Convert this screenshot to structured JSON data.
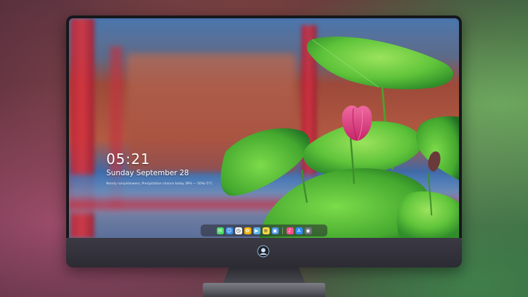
{
  "lockscreen": {
    "time": "05:21",
    "date": "Sunday September  28",
    "status": "Nearly rainy/showers, Precipitation chance today 39% — 50%/-5°C"
  },
  "dock": {
    "icons": [
      {
        "name": "messages-icon",
        "glyph": "✉",
        "color": "#4cd964"
      },
      {
        "name": "finder-icon",
        "glyph": "☺",
        "color": "#3a8ee6"
      },
      {
        "name": "clock-icon",
        "glyph": "◷",
        "color": "#f2f2f2"
      },
      {
        "name": "photos-icon",
        "glyph": "✿",
        "color": "#f5b400"
      },
      {
        "name": "claquette-icon",
        "glyph": "▶",
        "color": "#5ab4e8"
      },
      {
        "name": "notes-icon",
        "glyph": "≡",
        "color": "#ffd84a"
      },
      {
        "name": "gallery-icon",
        "glyph": "▣",
        "color": "#4a90e2"
      },
      {
        "name": "music-icon",
        "glyph": "♪",
        "color": "#ff4f8b"
      },
      {
        "name": "app-store-icon",
        "glyph": "A",
        "color": "#2f8cff"
      },
      {
        "name": "camera-icon",
        "glyph": "◉",
        "color": "#6e7280"
      }
    ]
  },
  "colors": {
    "monitor_bezel": "#16171b",
    "chin": "#3b3a44",
    "leaf_green": "#5fc43a",
    "lotus_pink": "#e0457f"
  }
}
